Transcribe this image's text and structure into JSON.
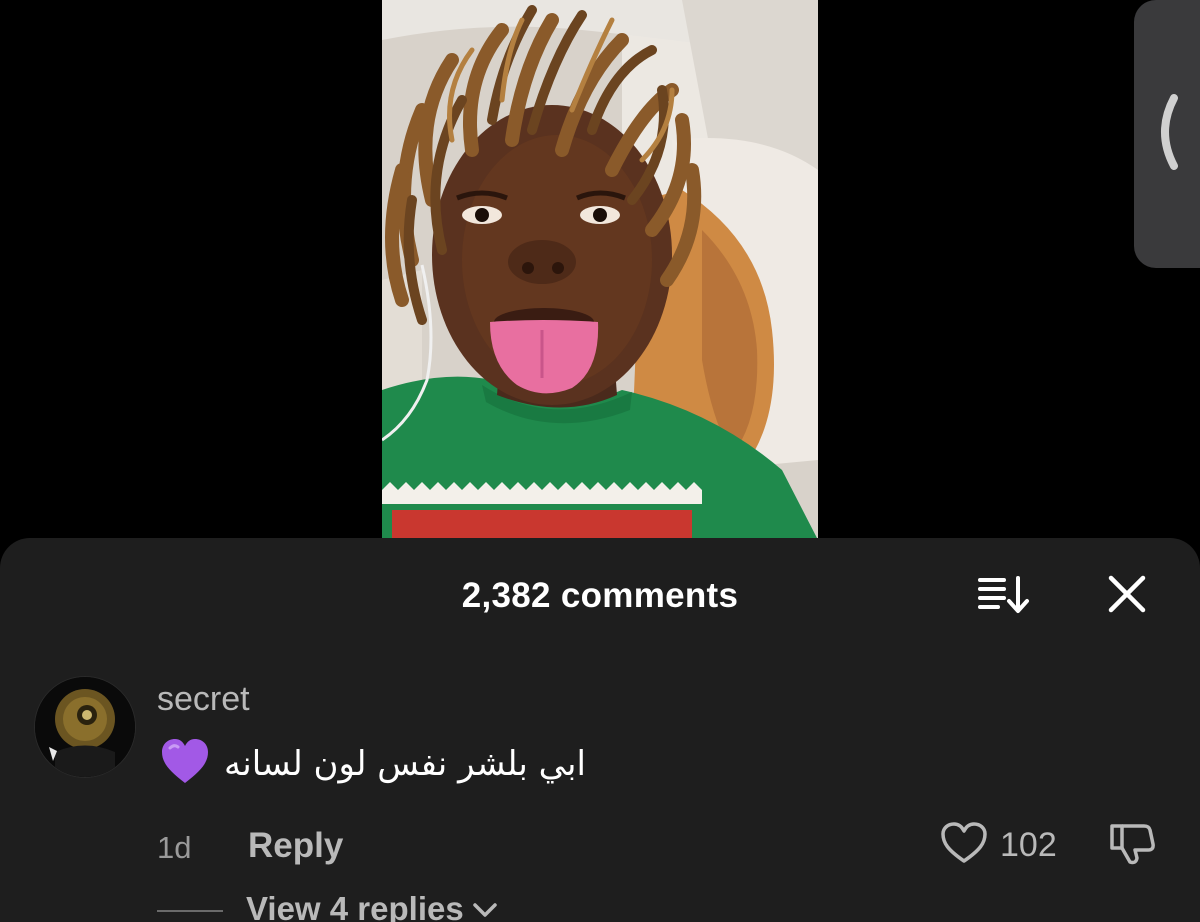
{
  "sheet": {
    "comment_count_label": "2,382 comments"
  },
  "comment": {
    "username": "secret",
    "emoji": "purple-heart",
    "text": "ابي بلشر نفس لون لسانه",
    "time": "1d",
    "reply_label": "Reply",
    "like_count": "102",
    "view_replies_label": "View 4 replies"
  },
  "icons": {
    "side_tab": "chevron-left-icon",
    "sort": "sort-icon",
    "close": "close-icon",
    "like": "heart-outline-icon",
    "dislike": "thumbs-down-icon",
    "expand": "chevron-down-icon"
  },
  "colors": {
    "sheet_background": "#1e1e1e",
    "secondary_text": "#b9b9b9",
    "emoji_heart": "#a259e6"
  }
}
